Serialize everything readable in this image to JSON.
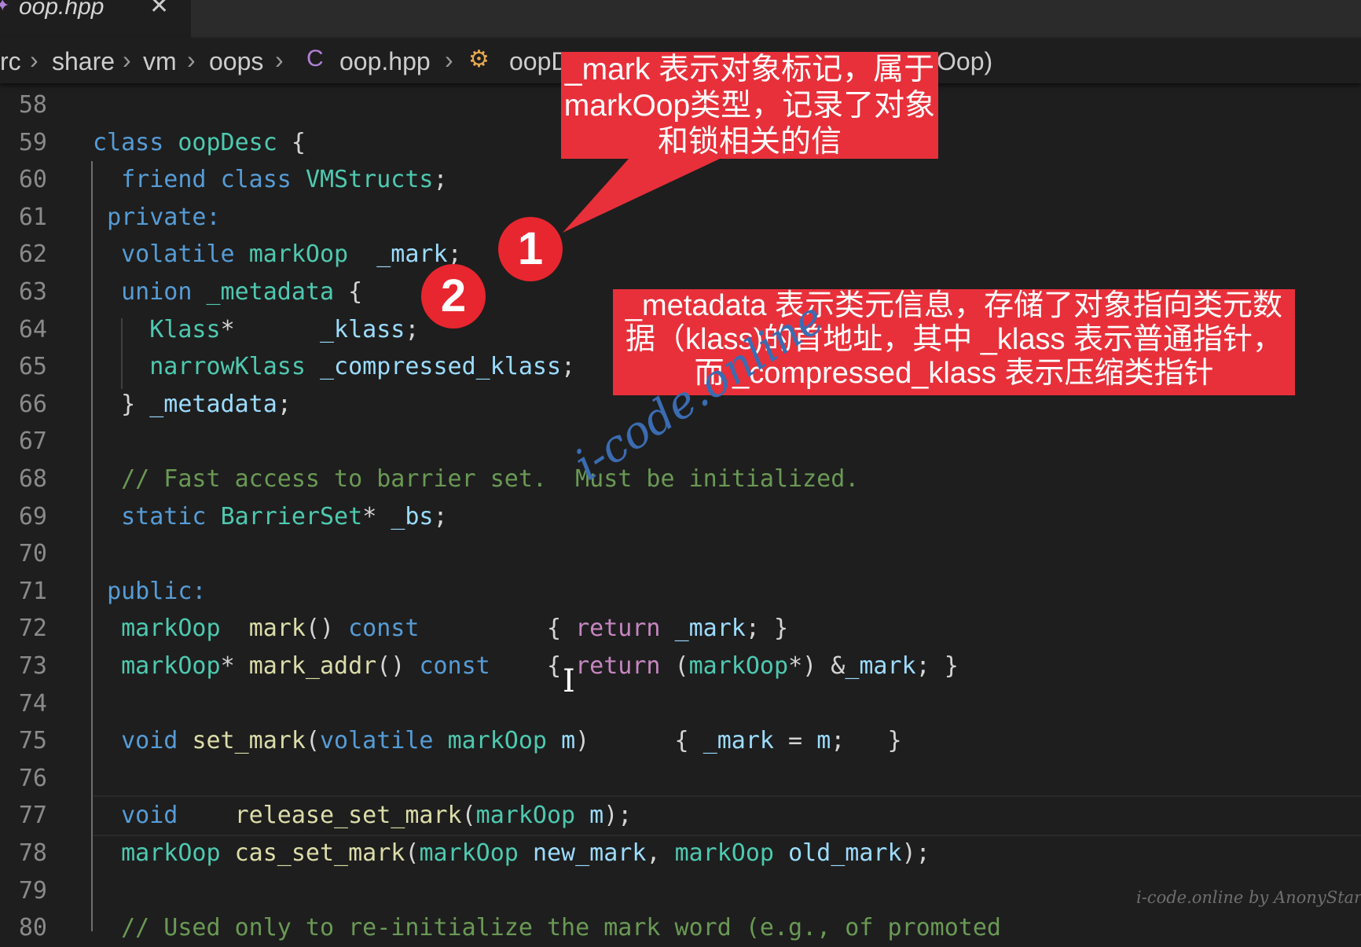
{
  "tab": {
    "title": "oop.hpp",
    "close": "✕"
  },
  "breadcrumb": {
    "items": [
      "rc",
      "share",
      "vm",
      "oops",
      "oop.hpp",
      "oopD",
      "Oop)"
    ],
    "separator": "›"
  },
  "lines": [
    {
      "n": "58",
      "segs": []
    },
    {
      "n": "59",
      "segs": [
        {
          "t": "class",
          "c": "kw"
        },
        {
          "t": " "
        },
        {
          "t": "oopDesc",
          "c": "ty"
        },
        {
          "t": " {"
        }
      ]
    },
    {
      "n": "60",
      "segs": [
        {
          "t": "  "
        },
        {
          "t": "friend",
          "c": "kw"
        },
        {
          "t": " "
        },
        {
          "t": "class",
          "c": "kw"
        },
        {
          "t": " "
        },
        {
          "t": "VMStructs",
          "c": "ty"
        },
        {
          "t": ";"
        }
      ]
    },
    {
      "n": "61",
      "segs": [
        {
          "t": " "
        },
        {
          "t": "private:",
          "c": "kw"
        }
      ]
    },
    {
      "n": "62",
      "segs": [
        {
          "t": "  "
        },
        {
          "t": "volatile",
          "c": "kw"
        },
        {
          "t": " "
        },
        {
          "t": "markOop",
          "c": "ty"
        },
        {
          "t": "  "
        },
        {
          "t": "_mark",
          "c": "va"
        },
        {
          "t": ";"
        }
      ]
    },
    {
      "n": "63",
      "segs": [
        {
          "t": "  "
        },
        {
          "t": "union",
          "c": "kw"
        },
        {
          "t": " "
        },
        {
          "t": "_metadata",
          "c": "ty"
        },
        {
          "t": " {"
        }
      ]
    },
    {
      "n": "64",
      "segs": [
        {
          "t": "    "
        },
        {
          "t": "Klass",
          "c": "ty"
        },
        {
          "t": "*      "
        },
        {
          "t": "_klass",
          "c": "va"
        },
        {
          "t": ";"
        }
      ]
    },
    {
      "n": "65",
      "segs": [
        {
          "t": "    "
        },
        {
          "t": "narrowKlass",
          "c": "ty"
        },
        {
          "t": " "
        },
        {
          "t": "_compressed_klass",
          "c": "va"
        },
        {
          "t": ";"
        }
      ]
    },
    {
      "n": "66",
      "segs": [
        {
          "t": "  } "
        },
        {
          "t": "_metadata",
          "c": "va"
        },
        {
          "t": ";"
        }
      ]
    },
    {
      "n": "67",
      "segs": []
    },
    {
      "n": "68",
      "segs": [
        {
          "t": "  "
        },
        {
          "t": "// Fast access to barrier set.  Must be initialized.",
          "c": "cm"
        }
      ]
    },
    {
      "n": "69",
      "segs": [
        {
          "t": "  "
        },
        {
          "t": "static",
          "c": "kw"
        },
        {
          "t": " "
        },
        {
          "t": "BarrierSet",
          "c": "ty"
        },
        {
          "t": "* "
        },
        {
          "t": "_bs",
          "c": "va"
        },
        {
          "t": ";"
        }
      ]
    },
    {
      "n": "70",
      "segs": []
    },
    {
      "n": "71",
      "segs": [
        {
          "t": " "
        },
        {
          "t": "public:",
          "c": "kw"
        }
      ]
    },
    {
      "n": "72",
      "segs": [
        {
          "t": "  "
        },
        {
          "t": "markOop",
          "c": "ty"
        },
        {
          "t": "  "
        },
        {
          "t": "mark",
          "c": "fn"
        },
        {
          "t": "() "
        },
        {
          "t": "const",
          "c": "kw"
        },
        {
          "t": "         { "
        },
        {
          "t": "return",
          "c": "ct"
        },
        {
          "t": " "
        },
        {
          "t": "_mark",
          "c": "va"
        },
        {
          "t": "; }"
        }
      ]
    },
    {
      "n": "73",
      "segs": [
        {
          "t": "  "
        },
        {
          "t": "markOop",
          "c": "ty"
        },
        {
          "t": "* "
        },
        {
          "t": "mark_addr",
          "c": "fn"
        },
        {
          "t": "() "
        },
        {
          "t": "const",
          "c": "kw"
        },
        {
          "t": "    { "
        },
        {
          "t": "return",
          "c": "ct"
        },
        {
          "t": " ("
        },
        {
          "t": "markOop",
          "c": "ty"
        },
        {
          "t": "*) &"
        },
        {
          "t": "_mark",
          "c": "va"
        },
        {
          "t": "; }"
        }
      ]
    },
    {
      "n": "74",
      "segs": []
    },
    {
      "n": "75",
      "segs": [
        {
          "t": "  "
        },
        {
          "t": "void",
          "c": "kw"
        },
        {
          "t": " "
        },
        {
          "t": "set_mark",
          "c": "fn"
        },
        {
          "t": "("
        },
        {
          "t": "volatile",
          "c": "kw"
        },
        {
          "t": " "
        },
        {
          "t": "markOop",
          "c": "ty"
        },
        {
          "t": " "
        },
        {
          "t": "m",
          "c": "va"
        },
        {
          "t": ")      { "
        },
        {
          "t": "_mark",
          "c": "va"
        },
        {
          "t": " = "
        },
        {
          "t": "m",
          "c": "va"
        },
        {
          "t": ";   }"
        }
      ]
    },
    {
      "n": "76",
      "segs": []
    },
    {
      "n": "77",
      "segs": [
        {
          "t": "  "
        },
        {
          "t": "void",
          "c": "kw"
        },
        {
          "t": "    "
        },
        {
          "t": "release_set_mark",
          "c": "fn"
        },
        {
          "t": "("
        },
        {
          "t": "markOop",
          "c": "ty"
        },
        {
          "t": " "
        },
        {
          "t": "m",
          "c": "va"
        },
        {
          "t": ");"
        }
      ]
    },
    {
      "n": "78",
      "segs": [
        {
          "t": "  "
        },
        {
          "t": "markOop",
          "c": "ty"
        },
        {
          "t": " "
        },
        {
          "t": "cas_set_mark",
          "c": "fn"
        },
        {
          "t": "("
        },
        {
          "t": "markOop",
          "c": "ty"
        },
        {
          "t": " "
        },
        {
          "t": "new_mark",
          "c": "va"
        },
        {
          "t": ", "
        },
        {
          "t": "markOop",
          "c": "ty"
        },
        {
          "t": " "
        },
        {
          "t": "old_mark",
          "c": "va"
        },
        {
          "t": ");"
        }
      ]
    },
    {
      "n": "79",
      "segs": []
    },
    {
      "n": "80",
      "segs": [
        {
          "t": "  "
        },
        {
          "t": "// Used only to re-initialize the mark word (e.g., of promoted",
          "c": "cm"
        }
      ]
    }
  ],
  "annotations": {
    "callout1": "_mark 表示对象标记，属于markOop类型，记录了对象和锁相关的信",
    "callout2": "_metadata 表示类元信息，存储了对象指向类元数据（klass)的首地址，其中 _klass 表示普通指针，而 _compressed_klass 表示压缩类指针",
    "badge1": "1",
    "badge2": "2",
    "watermark": "i-code.online",
    "signature": "i-code.online by AnonyStar"
  },
  "colors": {
    "background": "#1e1e1e",
    "callout": "#e8303a",
    "keyword": "#569cd6",
    "type": "#4ec9b0",
    "control": "#c586c0",
    "comment": "#6a9955",
    "variable": "#9cdcfe",
    "function": "#dcdcaa"
  }
}
